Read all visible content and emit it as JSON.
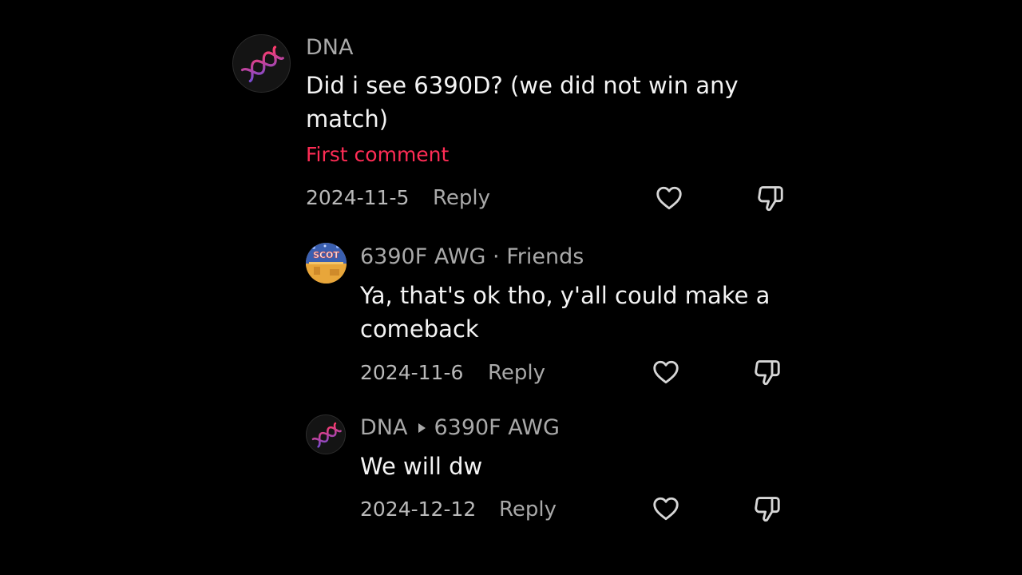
{
  "comments": [
    {
      "author": "DNA",
      "text": "Did i see 6390D? (we did not win any match)",
      "tag": "First comment",
      "date": "2024-11-5",
      "reply_label": "Reply",
      "avatar_icon": "dna-helix-icon"
    },
    {
      "author": "6390F AWG",
      "relation": "· Friends",
      "text": "Ya, that's ok tho, y'all could make a comeback",
      "date": "2024-11-6",
      "reply_label": "Reply",
      "avatar_icon": "scot-court-avatar",
      "avatar_text": "SCOT"
    },
    {
      "author": "DNA",
      "reply_to": "6390F AWG",
      "text": "We will dw",
      "date": "2024-12-12",
      "reply_label": "Reply",
      "avatar_icon": "dna-helix-icon"
    }
  ],
  "colors": {
    "background": "#000000",
    "first_comment_tag": "#fe2c55",
    "helix_pink": "#ff3b6b",
    "helix_purple": "#7a4bd1"
  },
  "icons": {
    "like": "heart-icon",
    "dislike": "thumbs-down-icon"
  }
}
